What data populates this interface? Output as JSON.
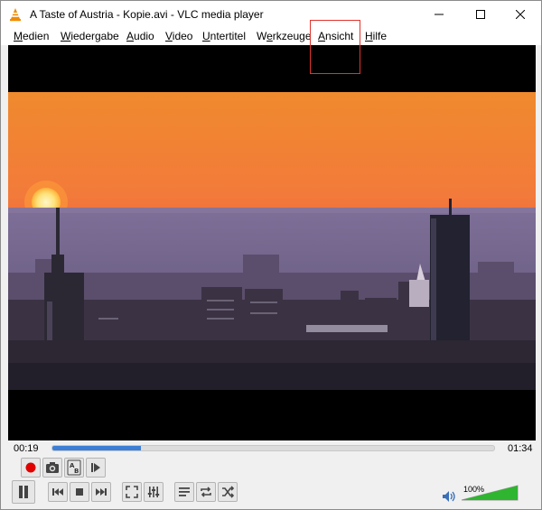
{
  "window": {
    "title": "A Taste of Austria - Kopie.avi - VLC media player",
    "app_icon": "vlc-cone-icon",
    "controls": {
      "minimize_icon": "minimize-icon",
      "maximize_icon": "maximize-icon",
      "close_icon": "close-icon"
    }
  },
  "menu": {
    "items": [
      {
        "label_u": "M",
        "label_rest": "edien"
      },
      {
        "label_u": "W",
        "label_rest": "iedergabe"
      },
      {
        "label_u": "A",
        "label_rest": "udio"
      },
      {
        "label_u": "V",
        "label_rest": "ideo"
      },
      {
        "label_u": "U",
        "label_rest": "ntertitel"
      },
      {
        "label_pre": "W",
        "label_u": "e",
        "label_rest": "rkzeuge"
      },
      {
        "label_u": "A",
        "label_rest": "nsicht"
      },
      {
        "label_u": "H",
        "label_rest": "ilfe"
      }
    ],
    "highlighted": "Ansicht"
  },
  "playback": {
    "elapsed": "00:19",
    "total": "01:34",
    "progress": 0.2
  },
  "advanced_controls": {
    "icons": [
      "record-icon",
      "snapshot-icon",
      "ab-loop-icon",
      "frame-step-icon"
    ],
    "ab_label_a": "A",
    "ab_label_b": "B"
  },
  "main_controls": {
    "icons": [
      "pause-icon",
      "previous-icon",
      "stop-icon",
      "next-icon",
      "fullscreen-icon",
      "extended-settings-icon",
      "playlist-icon",
      "loop-icon",
      "shuffle-icon"
    ]
  },
  "volume": {
    "label": "100%",
    "level": 1.0,
    "icon": "speaker-icon"
  },
  "colors": {
    "seek_fill": "#3d7fd6",
    "record_red": "#e00000",
    "volume_green": "#2fb52f",
    "highlight_box": "#e0342c"
  }
}
